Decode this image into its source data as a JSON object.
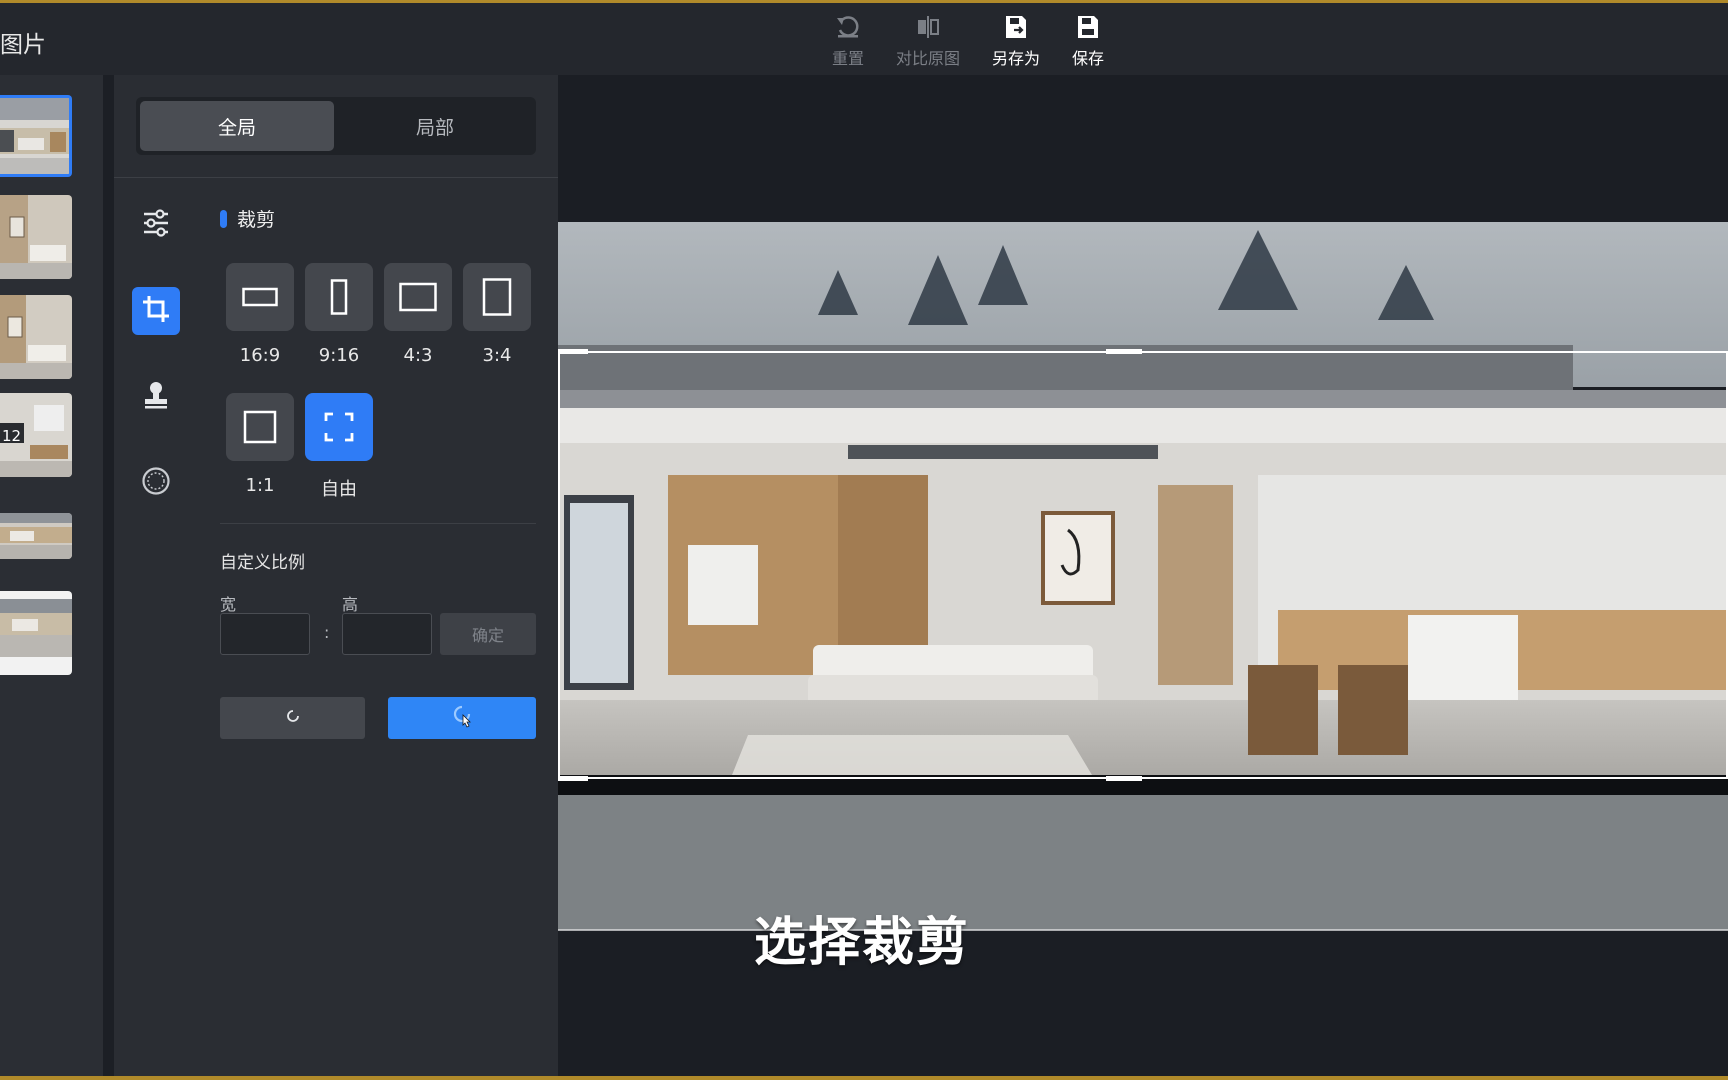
{
  "app": {
    "title": "图片"
  },
  "toolbar": {
    "reset_label": "重置",
    "compare_label": "对比原图",
    "save_as_label": "另存为",
    "save_label": "保存"
  },
  "thumbnails": [
    {
      "selected": true
    },
    {
      "selected": false
    },
    {
      "selected": false
    },
    {
      "selected": false,
      "badge": "12"
    },
    {
      "selected": false
    },
    {
      "selected": false
    }
  ],
  "panel": {
    "tabs": {
      "global": "全局",
      "local": "局部",
      "active": "全局"
    },
    "section_title": "裁剪",
    "side_tools": [
      "adjust-sliders-icon",
      "crop-icon",
      "stamp-icon",
      "circle-icon"
    ],
    "active_side_tool": "crop-icon",
    "ratios": [
      {
        "label": "16:9"
      },
      {
        "label": "9:16"
      },
      {
        "label": "4:3"
      },
      {
        "label": "3:4"
      },
      {
        "label": "1:1"
      },
      {
        "label": "自由",
        "active": true
      }
    ],
    "custom": {
      "title": "自定义比例",
      "width_label": "宽",
      "height_label": "高",
      "separator": ":",
      "width_value": "",
      "height_value": "",
      "confirm_label": "确定"
    }
  },
  "canvas": {
    "caption": "选择裁剪"
  },
  "colors": {
    "accent": "#2f7cf6",
    "topbar": "#24272d",
    "panel": "#2a2d33",
    "canvas": "#1b1e24",
    "frame_border": "#b08a2a"
  }
}
